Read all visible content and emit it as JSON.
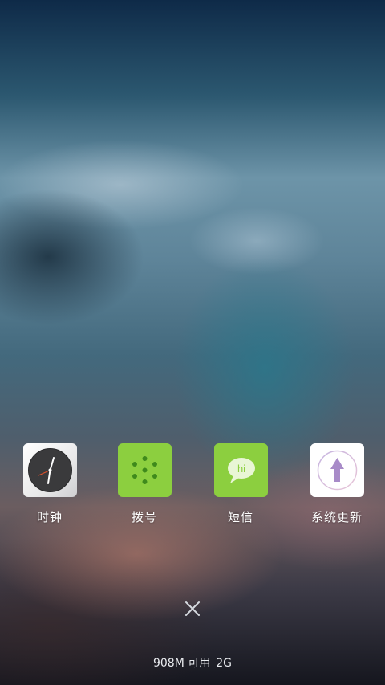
{
  "apps": [
    {
      "id": "clock",
      "label": "时钟",
      "icon": "clock-icon"
    },
    {
      "id": "dialer",
      "label": "拨号",
      "icon": "dialpad-icon"
    },
    {
      "id": "sms",
      "label": "短信",
      "icon": "sms-bubble-icon",
      "icon_text": "hi"
    },
    {
      "id": "update",
      "label": "系统更新",
      "icon": "system-update-icon"
    }
  ],
  "close_icon": "close-icon",
  "memory": {
    "available": "908M 可用",
    "total": "2G"
  },
  "colors": {
    "app_green": "#8ccf3f",
    "clock_face": "#3a3a3c",
    "update_arrow": "#a88bc8",
    "label_text": "#ffffff"
  }
}
